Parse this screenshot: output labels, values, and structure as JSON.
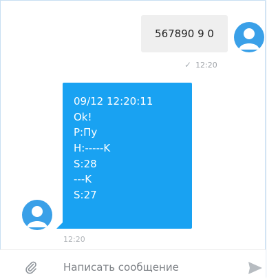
{
  "chat": {
    "outgoing": {
      "text": "567890 9 0",
      "time": "12:20",
      "status_icon": "check-icon"
    },
    "incoming": {
      "lines": [
        "09/12 12:20:11",
        "Ok!",
        "P:Пу",
        "H:-----K",
        "S:28",
        "---K",
        "S:27"
      ],
      "time": "12:20"
    }
  },
  "composer": {
    "placeholder": "Написать сообщение",
    "attach_icon": "paperclip-icon",
    "send_icon": "send-icon"
  },
  "colors": {
    "incoming_bubble": "#19a2f2",
    "outgoing_bubble": "#efefef",
    "avatar": "#3aa0e8"
  }
}
